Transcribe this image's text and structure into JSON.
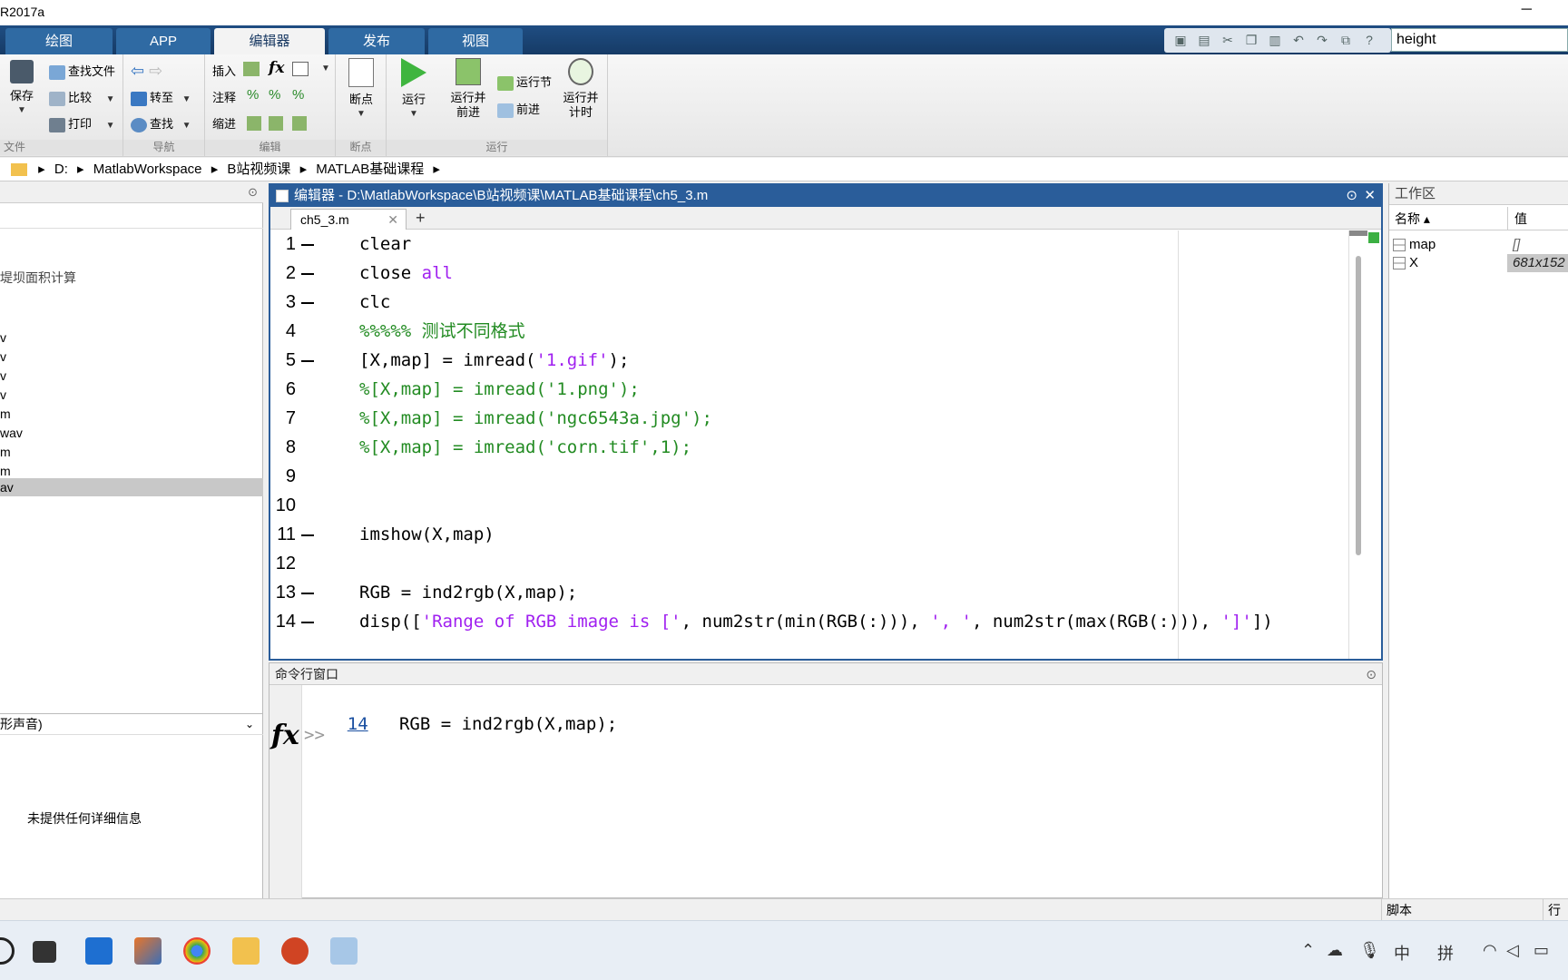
{
  "window": {
    "title": "R2017a",
    "minimize_glyph": "─"
  },
  "ribbon": {
    "tabs": [
      "绘图",
      "APP",
      "编辑器",
      "发布",
      "视图"
    ],
    "active_tab": "编辑器",
    "search_value": "height"
  },
  "toolstrip": {
    "file": {
      "save": "保存",
      "find_files": "查找文件",
      "compare": "比较",
      "print": "打印",
      "group": "文件"
    },
    "navigate": {
      "goto": "转至",
      "find": "查找",
      "group": "导航"
    },
    "edit": {
      "insert": "插入",
      "fx": "fx",
      "comment": "注释",
      "indent": "缩进",
      "percent": "%",
      "group": "编辑"
    },
    "breakpoints": {
      "label": "断点",
      "group": "断点"
    },
    "run": {
      "run": "运行",
      "run_advance_1": "运行并",
      "run_advance_2": "前进",
      "run_section": "运行节",
      "advance": "前进",
      "run_time_1": "运行并",
      "run_time_2": "计时",
      "group": "运行"
    }
  },
  "address": {
    "drive": "D:",
    "parts": [
      "MatlabWorkspace",
      "B站视频课",
      "MATLAB基础课程"
    ]
  },
  "left_panel": {
    "item_top": "堤坝面积计算",
    "items": [
      "v",
      "v",
      "v",
      "v",
      "m",
      "wav",
      "m",
      "m",
      "av"
    ],
    "details_dropdown": "形声音)",
    "details_text": "未提供任何详细信息"
  },
  "editor": {
    "title": "编辑器 - D:\\MatlabWorkspace\\B站视频课\\MATLAB基础课程\\ch5_3.m",
    "tab": "ch5_3.m",
    "lines": [
      {
        "n": "1",
        "dash": true,
        "parts": [
          {
            "t": "clear",
            "c": ""
          }
        ]
      },
      {
        "n": "2",
        "dash": true,
        "parts": [
          {
            "t": "close ",
            "c": ""
          },
          {
            "t": "all",
            "c": "c-str"
          }
        ]
      },
      {
        "n": "3",
        "dash": true,
        "parts": [
          {
            "t": "clc",
            "c": ""
          }
        ]
      },
      {
        "n": "4",
        "dash": false,
        "parts": [
          {
            "t": "%%%%% 测试不同格式",
            "c": "c-com"
          }
        ]
      },
      {
        "n": "5",
        "dash": true,
        "parts": [
          {
            "t": "[X,map] = imread(",
            "c": ""
          },
          {
            "t": "'1.gif'",
            "c": "c-str"
          },
          {
            "t": ");",
            "c": ""
          }
        ]
      },
      {
        "n": "6",
        "dash": false,
        "parts": [
          {
            "t": "%[X,map] = imread('1.png');",
            "c": "c-com"
          }
        ]
      },
      {
        "n": "7",
        "dash": false,
        "parts": [
          {
            "t": "%[X,map] = imread('ngc6543a.jpg');",
            "c": "c-com"
          }
        ]
      },
      {
        "n": "8",
        "dash": false,
        "parts": [
          {
            "t": "%[X,map] = imread('corn.tif',1);",
            "c": "c-com"
          }
        ]
      },
      {
        "n": "9",
        "dash": false,
        "parts": []
      },
      {
        "n": "10",
        "dash": false,
        "parts": []
      },
      {
        "n": "11",
        "dash": true,
        "parts": [
          {
            "t": "imshow(X,map)",
            "c": ""
          }
        ]
      },
      {
        "n": "12",
        "dash": false,
        "parts": []
      },
      {
        "n": "13",
        "dash": true,
        "parts": [
          {
            "t": "RGB = ind2rgb(X,map);",
            "c": ""
          }
        ]
      },
      {
        "n": "14",
        "dash": true,
        "parts": [
          {
            "t": "disp([",
            "c": ""
          },
          {
            "t": "'Range of RGB image is ['",
            "c": "c-str"
          },
          {
            "t": ", num2str(min(RGB(:))), ",
            "c": ""
          },
          {
            "t": "', '",
            "c": "c-str"
          },
          {
            "t": ", num2str(max(RGB(:))), ",
            "c": ""
          },
          {
            "t": "']'",
            "c": "c-str"
          },
          {
            "t": "])",
            "c": ""
          }
        ]
      }
    ]
  },
  "command_window": {
    "title": "命令行窗口",
    "line_num": "14",
    "line_text": "RGB = ind2rgb(X,map);",
    "fx": "fx",
    "prompt": ">>"
  },
  "workspace": {
    "title": "工作区",
    "col_name": "名称 ▴",
    "col_value": "值",
    "vars": [
      {
        "name": "map",
        "value": "[]"
      },
      {
        "name": "X",
        "value": "681x152"
      }
    ]
  },
  "status": {
    "left": "脚本",
    "right": "行"
  },
  "taskbar": {
    "ime1": "中",
    "ime2": "拼"
  },
  "colors": {
    "ribbon_blue": "#1f4d82",
    "editor_border": "#2a5d9a",
    "string": "#a020f0",
    "comment": "#228b22"
  }
}
